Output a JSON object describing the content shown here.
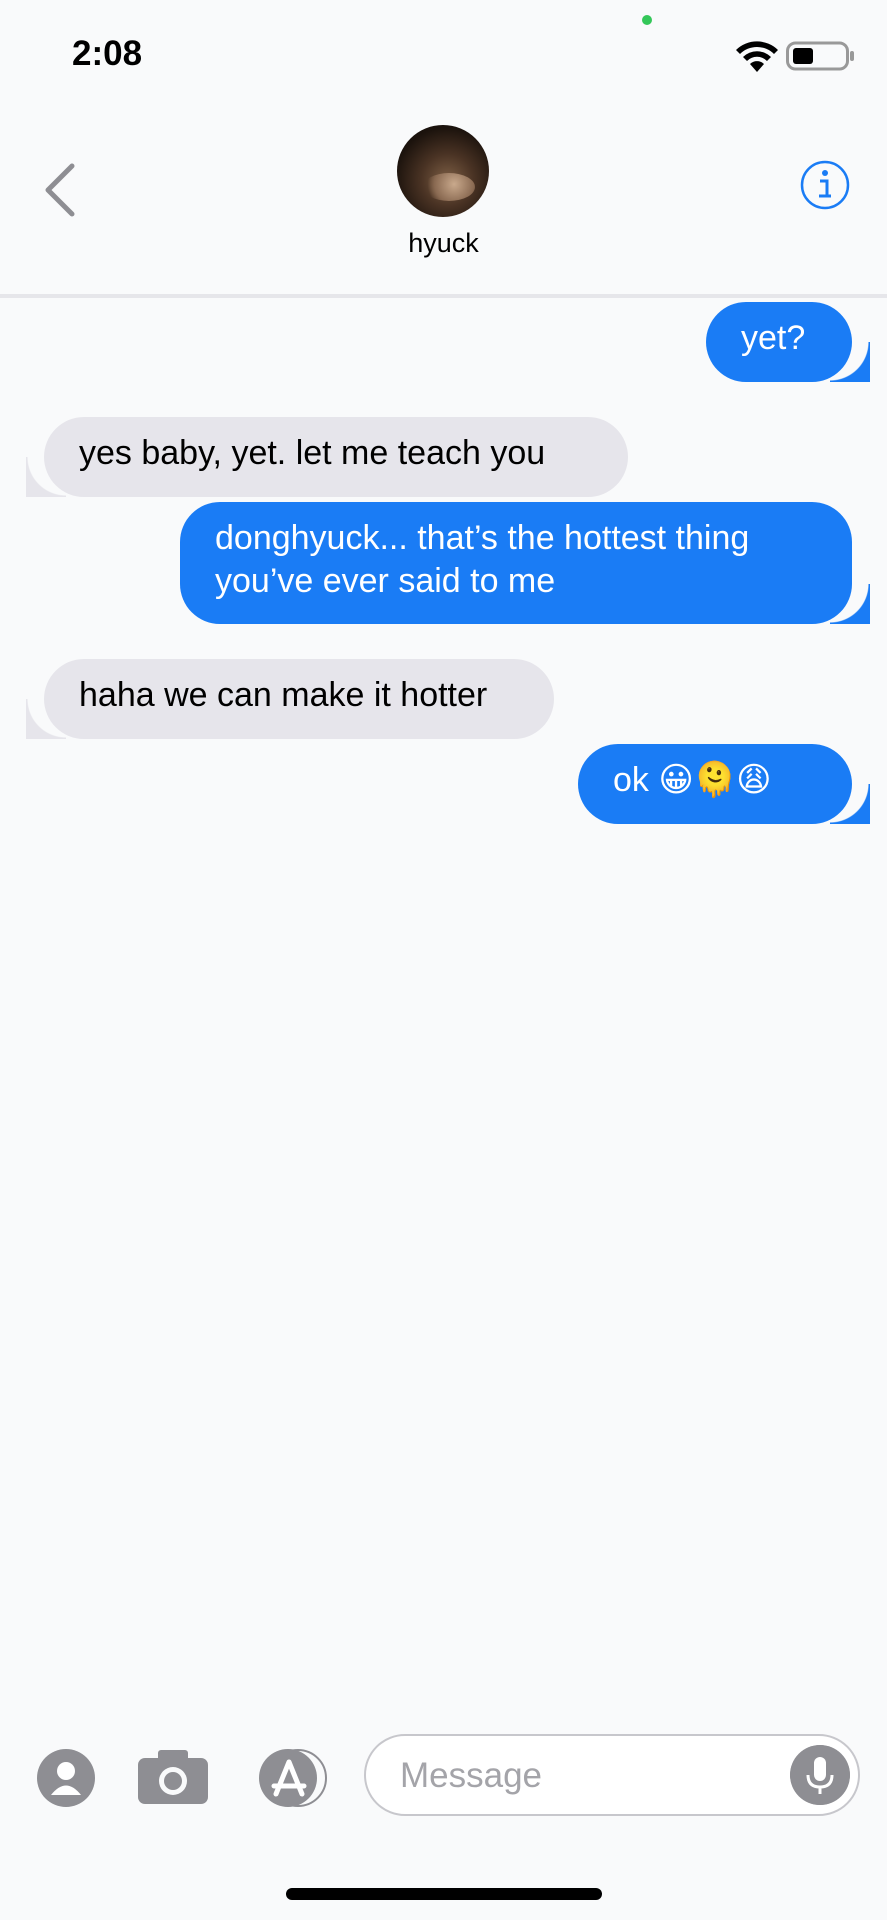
{
  "status": {
    "time": "2:08"
  },
  "header": {
    "contact_name": "hyuck"
  },
  "messages": [
    {
      "side": "sent",
      "text": "yet?"
    },
    {
      "side": "received",
      "text": "yes baby, yet. let me teach you"
    },
    {
      "side": "sent",
      "text": "donghyuck... that’s the hottest thing you’ve ever said to me"
    },
    {
      "side": "received",
      "text": "haha we can make it hotter"
    },
    {
      "side": "sent",
      "text": "ok 😀🫠😩"
    }
  ],
  "composer": {
    "placeholder": "Message"
  },
  "colors": {
    "sent_bubble": "#1a7cf5",
    "received_bubble": "#e6e5eb",
    "accent": "#1a7cf5"
  }
}
